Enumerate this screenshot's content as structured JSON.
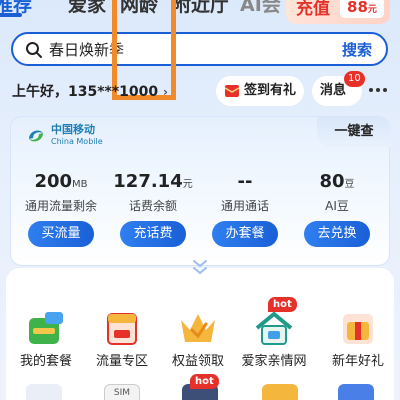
{
  "tabs": [
    {
      "label": "推荐",
      "active": true
    },
    {
      "label": "爱家",
      "active": false
    },
    {
      "label": "网龄",
      "active": false
    },
    {
      "label": "附近厅",
      "active": false
    },
    {
      "label": "AI会",
      "active": false
    }
  ],
  "promo": {
    "label": "充值",
    "price": "88",
    "unit": "元"
  },
  "search": {
    "value": "春日焕新季",
    "button_label": "搜索"
  },
  "greeting": {
    "text": "上午好，135***1000",
    "chevron": "›"
  },
  "signin": {
    "label": "签到有礼"
  },
  "messages": {
    "label": "消息",
    "badge": "10"
  },
  "account": {
    "provider_name": "中国移动",
    "provider_name_en": "China Mobile",
    "quick_check_label": "一键查",
    "stats": [
      {
        "value": "200",
        "unit": "MB",
        "label": "通用流量剩余",
        "button": "买流量"
      },
      {
        "value": "127.14",
        "unit": "元",
        "label": "话费余额",
        "button": "充话费"
      },
      {
        "value": "--",
        "unit": "",
        "label": "通用通话",
        "button": "办套餐"
      },
      {
        "value": "80",
        "unit": "豆",
        "label": "AI豆",
        "button": "去兑换"
      }
    ]
  },
  "services": [
    {
      "label": "我的套餐",
      "icon": "package-icon"
    },
    {
      "label": "流量专区",
      "icon": "data-zone-icon"
    },
    {
      "label": "权益领取",
      "icon": "crown-icon"
    },
    {
      "label": "爱家亲情网",
      "icon": "family-home-icon",
      "badge": "hot"
    },
    {
      "label": "新年好礼",
      "icon": "gift-icon"
    }
  ],
  "second_row": {
    "sim_label": "SIM",
    "badge": "hot"
  },
  "colors": {
    "accent": "#1a5fd6",
    "alert": "#e6312b",
    "marker": "#f08a2a"
  }
}
